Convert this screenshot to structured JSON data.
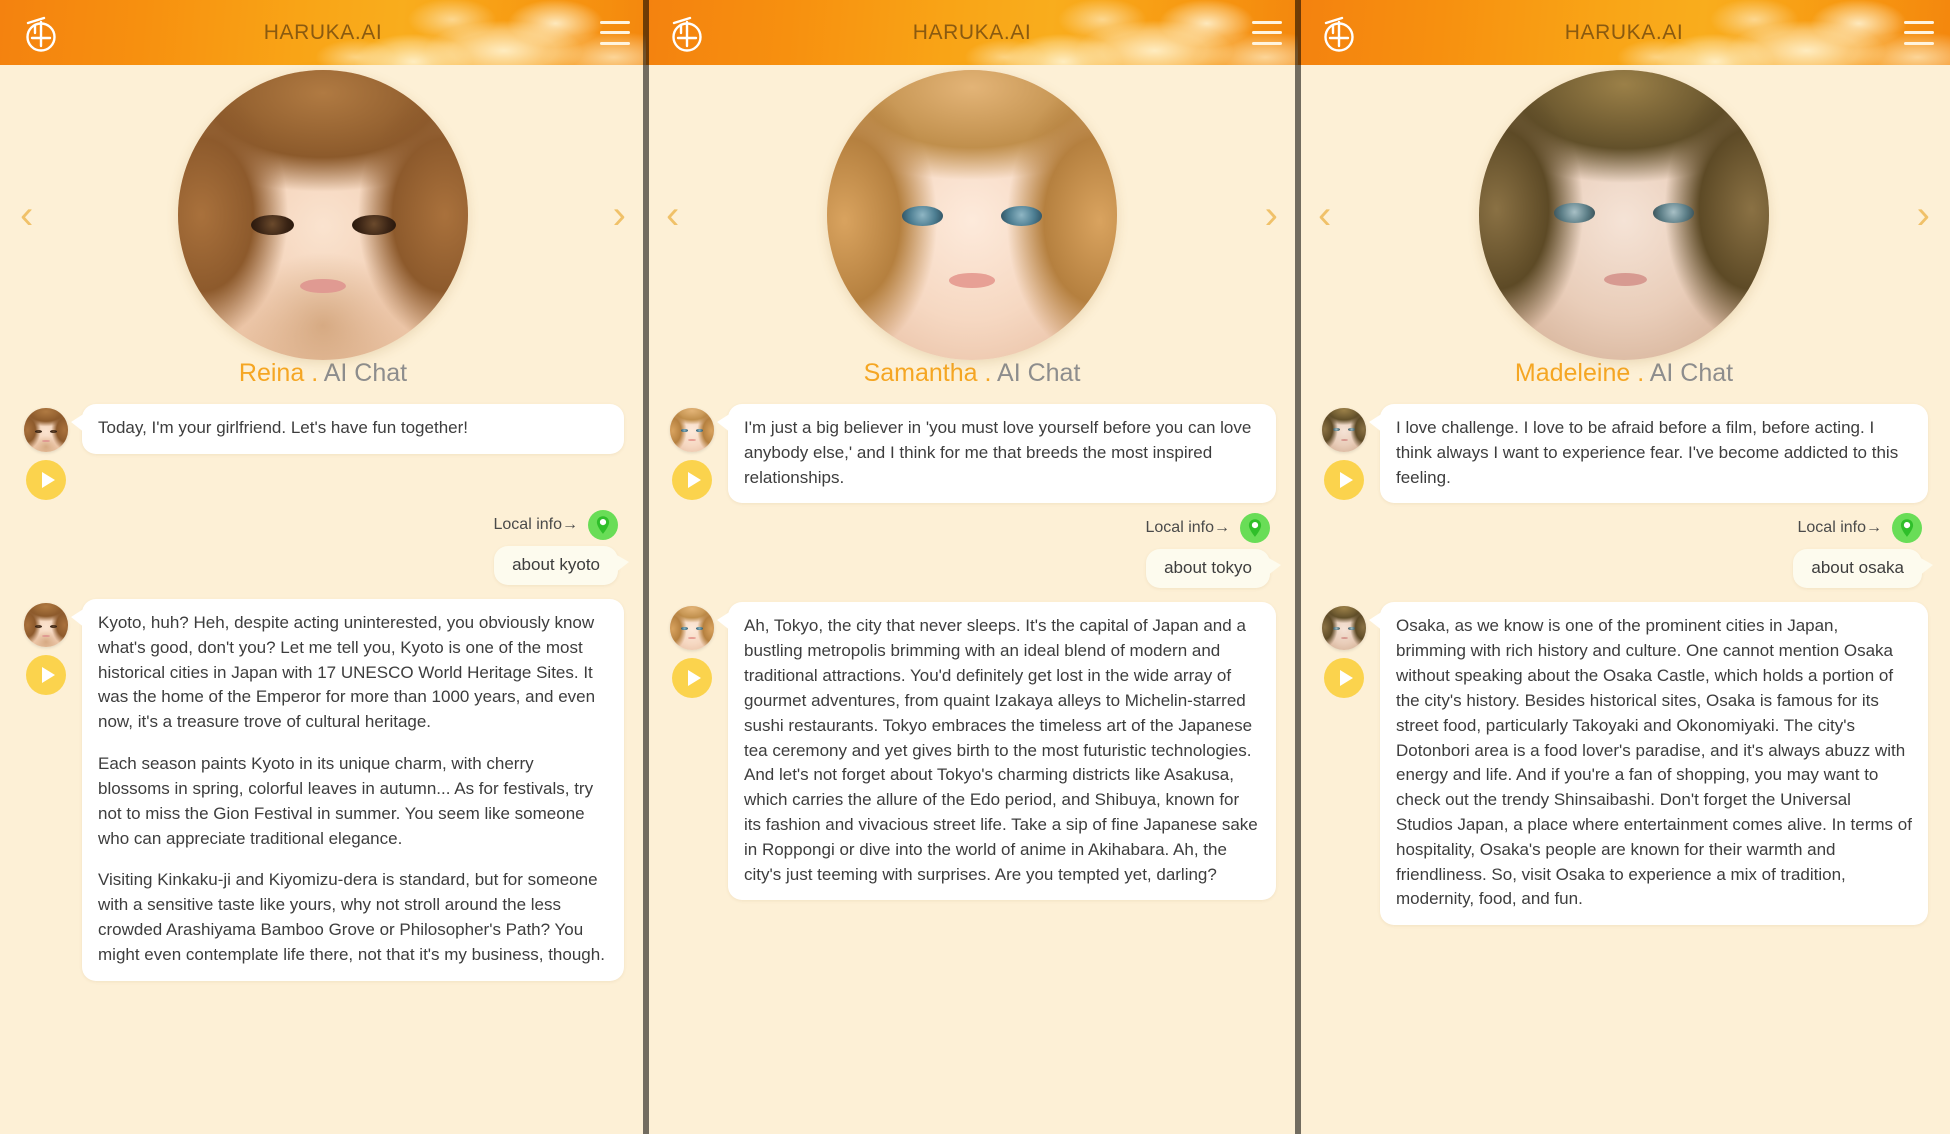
{
  "app": {
    "title": "HARUKA.AI",
    "logo_icon": "haruka-kanji-logo",
    "menu_icon": "hamburger-menu-icon"
  },
  "nav": {
    "prev_icon": "chevron-left-icon",
    "next_icon": "chevron-right-icon"
  },
  "common": {
    "name_separator": ".",
    "role_label": "AI Chat",
    "local_info_label": "Local info→",
    "pin_icon": "map-pin-icon",
    "play_icon": "play-icon"
  },
  "panels": [
    {
      "character_name": "Reina",
      "role": "AI Chat",
      "avatar_name": "reina-avatar",
      "intro_message": "Today, I'm your girlfriend. Let's have fun together!",
      "local_info_label": "Local info→",
      "user_message": "about kyoto",
      "reply_paragraphs": [
        "Kyoto, huh? Heh, despite acting uninterested, you obviously know what's good, don't you? Let me tell you, Kyoto is one of the most historical cities in Japan with 17 UNESCO World Heritage Sites. It was the home of the Emperor for more than 1000 years, and even now, it's a treasure trove of cultural heritage.",
        "Each season paints Kyoto in its unique charm, with cherry blossoms in spring, colorful leaves in autumn... As for festivals, try not to miss the Gion Festival in summer. You seem like someone who can appreciate traditional elegance.",
        "Visiting Kinkaku-ji and Kiyomizu-dera is standard, but for someone with a sensitive taste like yours, why not stroll around the less crowded Arashiyama Bamboo Grove or Philosopher's Path? You might even contemplate life there, not that it's my business, though."
      ]
    },
    {
      "character_name": "Samantha",
      "role": "AI Chat",
      "avatar_name": "samantha-avatar",
      "intro_message": "I'm just a big believer in 'you must love yourself before you can love anybody else,' and I think for me that breeds the most inspired relationships.",
      "local_info_label": "Local info→",
      "user_message": "about tokyo",
      "reply_paragraphs": [
        "Ah, Tokyo, the city that never sleeps. It's the capital of Japan and a bustling metropolis brimming with an ideal blend of modern and traditional attractions. You'd definitely get lost in the wide array of gourmet adventures, from quaint Izakaya alleys to Michelin-starred sushi restaurants. Tokyo embraces the timeless art of the Japanese tea ceremony and yet gives birth to the most futuristic technologies. And let's not forget about Tokyo's charming districts like Asakusa, which carries the allure of the Edo period, and Shibuya, known for its fashion and vivacious street life. Take a sip of fine Japanese sake in Roppongi or dive into the world of anime in Akihabara. Ah, the city's just teeming with surprises. Are you tempted yet, darling?"
      ]
    },
    {
      "character_name": "Madeleine",
      "role": "AI Chat",
      "avatar_name": "madeleine-avatar",
      "intro_message": "I love challenge. I love to be afraid before a film, before acting. I think always I want to experience fear. I've become addicted to this feeling.",
      "local_info_label": "Local info→",
      "user_message": "about osaka",
      "reply_paragraphs": [
        "Osaka, as we know is one of the prominent cities in Japan, brimming with rich history and culture. One cannot mention Osaka without speaking about the Osaka Castle, which holds a portion of the city's history. Besides historical sites, Osaka is famous for its street food, particularly Takoyaki and Okonomiyaki. The city's Dotonbori area is a food lover's paradise, and it's always abuzz with energy and life. And if you're a fan of shopping, you may want to check out the trendy Shinsaibashi. Don't forget the Universal Studios Japan, a place where entertainment comes alive. In terms of hospitality, Osaka's people are known for their warmth and friendliness. So, visit Osaka to experience a mix of tradition, modernity, food, and fun."
      ]
    }
  ],
  "colors": {
    "brand_orange": "#f5a623",
    "header_gradient_start": "#f4820f",
    "header_gradient_end": "#f9ad1d",
    "page_background": "#fdf0d6",
    "bubble_white": "#ffffff",
    "user_bubble": "#fdfbee",
    "play_button": "#fbd34d",
    "pin_green": "#69dd57",
    "title_text": "#8a5a10",
    "role_text": "#8d8d8d"
  }
}
